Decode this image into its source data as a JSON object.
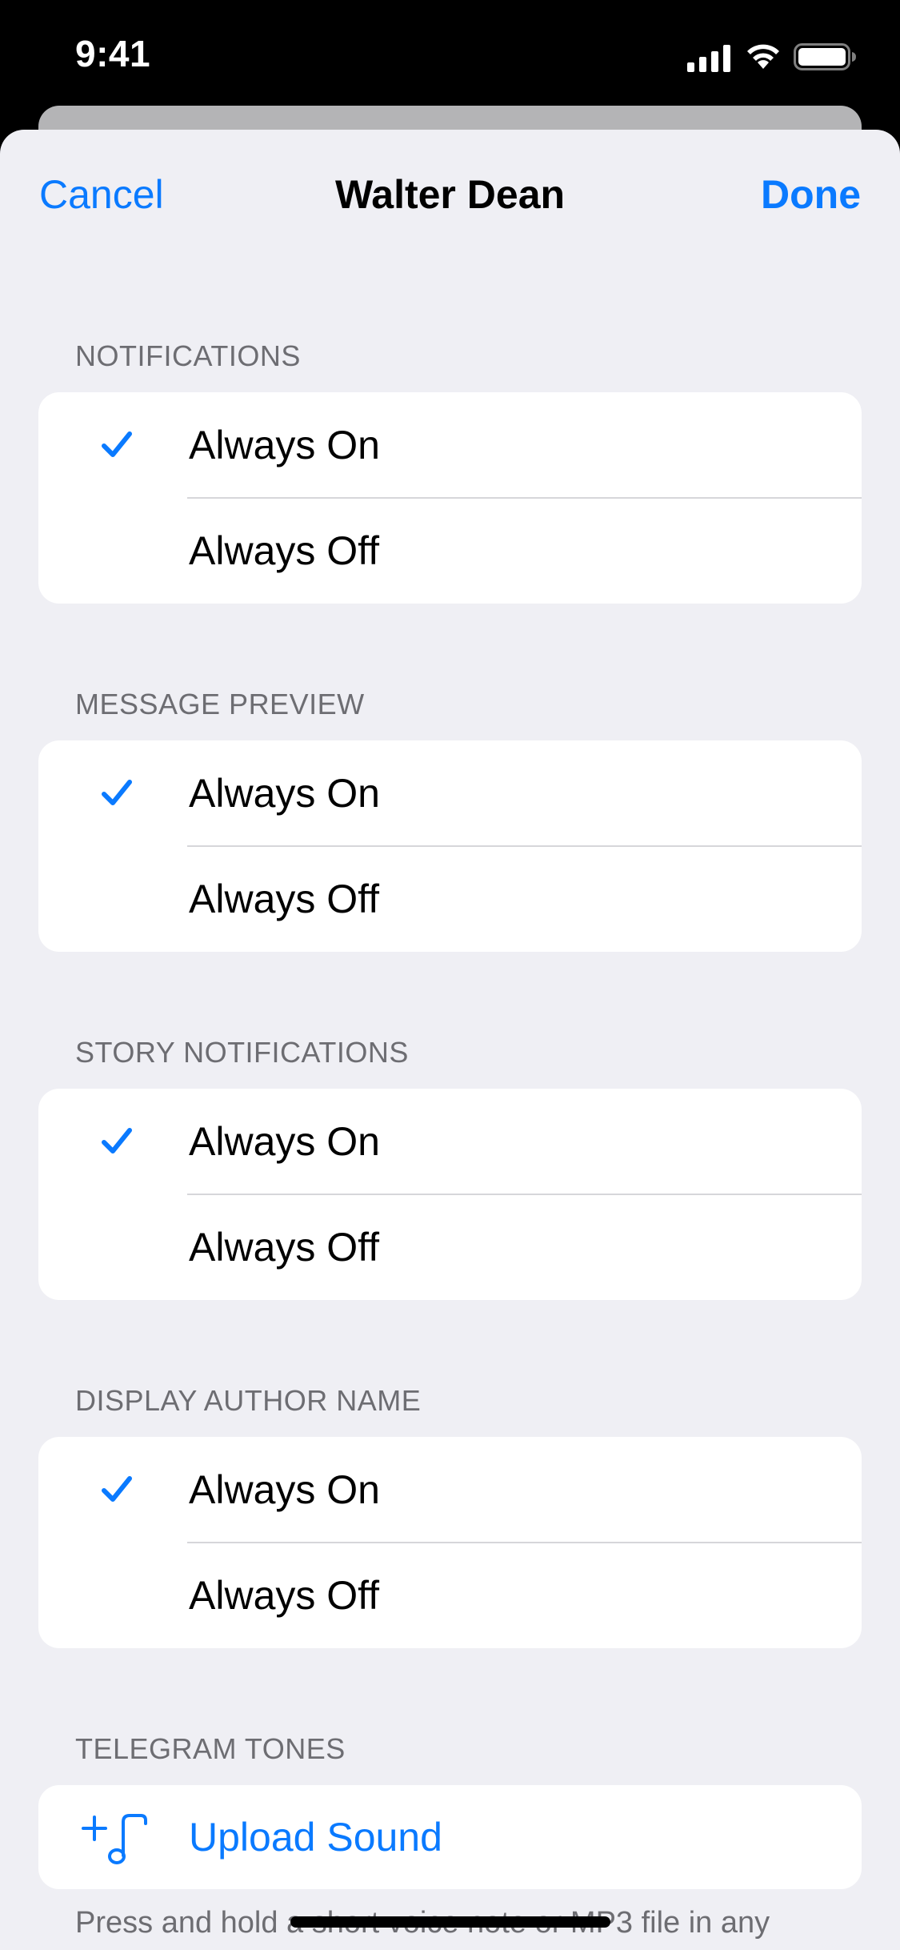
{
  "status_bar": {
    "time": "9:41"
  },
  "nav": {
    "cancel": "Cancel",
    "title": "Walter Dean",
    "done": "Done"
  },
  "sections": [
    {
      "header": "NOTIFICATIONS",
      "options": [
        "Always On",
        "Always Off"
      ],
      "selected": 0
    },
    {
      "header": "MESSAGE PREVIEW",
      "options": [
        "Always On",
        "Always Off"
      ],
      "selected": 0
    },
    {
      "header": "STORY NOTIFICATIONS",
      "options": [
        "Always On",
        "Always Off"
      ],
      "selected": 0
    },
    {
      "header": "DISPLAY AUTHOR NAME",
      "options": [
        "Always On",
        "Always Off"
      ],
      "selected": 0
    }
  ],
  "tones": {
    "header": "TELEGRAM TONES",
    "upload_label": "Upload Sound",
    "footer": "Press and hold a short voice note or MP3 file in any"
  },
  "colors": {
    "accent": "#0a7aff",
    "background": "#efeff4"
  }
}
